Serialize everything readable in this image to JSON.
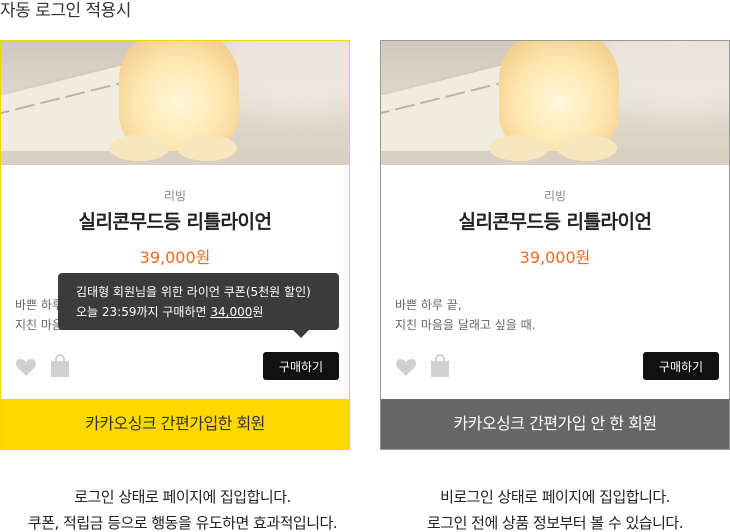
{
  "page_title": "자동 로그인 적용시",
  "cards": [
    {
      "category": "리빙",
      "product_name": "실리콘무드등 리틀라이언",
      "price": "39,000원",
      "description_line1": "바쁜 하루 끝,",
      "description_line2": "지친 마음을 달래고 싶을 때.",
      "buy_label": "구매하기",
      "footer_label": "카카오싱크 간편가입한 회원",
      "footer_color": "#ffd800"
    },
    {
      "category": "리빙",
      "product_name": "실리콘무드등 리틀라이언",
      "price": "39,000원",
      "description_line1": "바쁜 하루 끝,",
      "description_line2": "지친 마음을 달래고 싶을 때.",
      "buy_label": "구매하기",
      "footer_label": "카카오싱크 간편가입 안 한 회원",
      "footer_color": "#666666"
    }
  ],
  "tooltip": {
    "line1": "김태형 회원님을 위한 라이언 쿠폰(5천원 할인)",
    "line2_prefix": "오늘 23:59까지 구매하면 ",
    "line2_price": "34,000",
    "line2_suffix": "원"
  },
  "captions": {
    "left_line1": "로그인 상태로 페이지에 집입합니다.",
    "left_line2": "쿠폰, 적립금 등으로 행동을 유도하면 효과적입니다.",
    "right_line1": "비로그인 상태로 페이지에 집입합니다.",
    "right_line2": "로그인 전에 상품 정보부터 볼 수 있습니다."
  },
  "colors": {
    "price": "#f06a1e",
    "kakao_yellow": "#ffd800"
  },
  "icons": [
    "heart-icon",
    "shopping-bag-icon"
  ]
}
